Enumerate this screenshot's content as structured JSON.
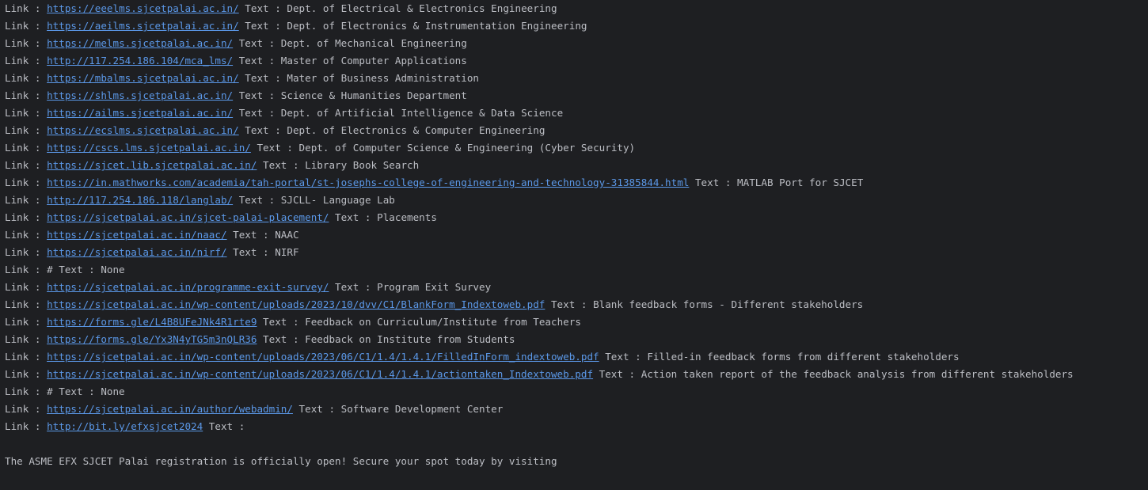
{
  "console": {
    "link_prefix": "Link : ",
    "text_prefix": " Text : ",
    "rows": [
      {
        "url": "https://eeelms.sjcetpalai.ac.in/",
        "text": "Dept. of Electrical & Electronics Engineering"
      },
      {
        "url": "https://aeilms.sjcetpalai.ac.in/",
        "text": "Dept. of Electronics & Instrumentation Engineering"
      },
      {
        "url": "https://melms.sjcetpalai.ac.in/",
        "text": "Dept. of Mechanical Engineering"
      },
      {
        "url": "http://117.254.186.104/mca_lms/",
        "text": "Master of Computer Applications"
      },
      {
        "url": "https://mbalms.sjcetpalai.ac.in/",
        "text": "Mater of Business Administration"
      },
      {
        "url": "https://shlms.sjcetpalai.ac.in/",
        "text": "Science & Humanities Department"
      },
      {
        "url": "https://ailms.sjcetpalai.ac.in/",
        "text": "Dept. of Artificial Intelligence & Data Science"
      },
      {
        "url": "https://ecslms.sjcetpalai.ac.in/",
        "text": "Dept. of Electronics & Computer Engineering"
      },
      {
        "url": "https://cscs.lms.sjcetpalai.ac.in/",
        "text": "Dept. of Computer Science & Engineering (Cyber Security)"
      },
      {
        "url": "https://sjcet.lib.sjcetpalai.ac.in/",
        "text": "Library Book Search"
      },
      {
        "url": "https://in.mathworks.com/academia/tah-portal/st-josephs-college-of-engineering-and-technology-31385844.html",
        "text": "MATLAB Port for SJCET"
      },
      {
        "url": "http://117.254.186.118/langlab/",
        "text": "SJCLL- Language Lab"
      },
      {
        "url": "https://sjcetpalai.ac.in/sjcet-palai-placement/",
        "text": "Placements"
      },
      {
        "url": "https://sjcetpalai.ac.in/naac/",
        "text": "NAAC"
      },
      {
        "url": "https://sjcetpalai.ac.in/nirf/",
        "text": "NIRF"
      },
      {
        "plain": "Link : # Text : None"
      },
      {
        "url": "https://sjcetpalai.ac.in/programme-exit-survey/",
        "text": "Program Exit Survey"
      },
      {
        "url": "https://sjcetpalai.ac.in/wp-content/uploads/2023/10/dvv/C1/BlankForm_Indextoweb.pdf",
        "text": "Blank feedback forms - Different stakeholders"
      },
      {
        "url": "https://forms.gle/L4B8UFeJNk4R1rte9",
        "text": "Feedback on Curriculum/Institute from Teachers"
      },
      {
        "url": "https://forms.gle/Yx3N4yTG5m3nQLR36",
        "text": "Feedback on Institute from Students"
      },
      {
        "url": "https://sjcetpalai.ac.in/wp-content/uploads/2023/06/C1/1.4/1.4.1/FilledInForm_indextoweb.pdf",
        "text": "Filled-in feedback forms from different stakeholders"
      },
      {
        "url": "https://sjcetpalai.ac.in/wp-content/uploads/2023/06/C1/1.4/1.4.1/actiontaken_Indextoweb.pdf",
        "text": "Action taken report of the feedback analysis from different stakeholders"
      },
      {
        "plain": "Link : # Text : None"
      },
      {
        "url": "https://sjcetpalai.ac.in/author/webadmin/",
        "text": "Software Development Center"
      },
      {
        "url": "http://bit.ly/efxsjcet2024",
        "text": ""
      }
    ],
    "footer_message": "The ASME EFX SJCET Palai registration is officially open! Secure your spot today by visiting"
  },
  "colors": {
    "background": "#1e1f22",
    "text": "#bcbec4",
    "link": "#5b98e8"
  }
}
